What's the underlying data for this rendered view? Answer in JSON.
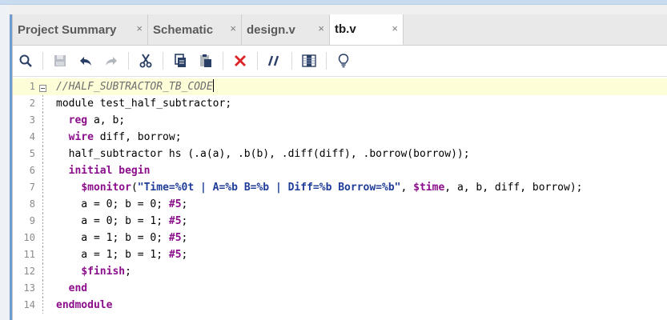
{
  "tabs": [
    {
      "label": "Project Summary",
      "active": false
    },
    {
      "label": "Schematic",
      "active": false
    },
    {
      "label": "design.v",
      "active": false
    },
    {
      "label": "tb.v",
      "active": true
    }
  ],
  "close_glyph": "×",
  "toolbar": [
    {
      "name": "search-icon"
    },
    {
      "name": "save-icon"
    },
    {
      "name": "undo-icon"
    },
    {
      "name": "redo-icon"
    },
    {
      "name": "cut-icon"
    },
    {
      "name": "copy-icon"
    },
    {
      "name": "paste-icon"
    },
    {
      "name": "delete-icon"
    },
    {
      "name": "comment-toggle-icon"
    },
    {
      "name": "column-block-icon"
    },
    {
      "name": "lightbulb-icon"
    }
  ],
  "editor": {
    "current_line": 1,
    "lines": [
      {
        "num": "1",
        "segs": [
          {
            "t": "//HALF_SUBTRACTOR_TB_CODE",
            "c": "cm"
          }
        ]
      },
      {
        "num": "2",
        "segs": [
          {
            "t": "module test_half_subtractor;",
            "c": ""
          }
        ]
      },
      {
        "num": "3",
        "segs": [
          {
            "t": "  ",
            "c": ""
          },
          {
            "t": "reg",
            "c": "k"
          },
          {
            "t": " a, b;",
            "c": ""
          }
        ]
      },
      {
        "num": "4",
        "segs": [
          {
            "t": "  ",
            "c": ""
          },
          {
            "t": "wire",
            "c": "k"
          },
          {
            "t": " diff, borrow;",
            "c": ""
          }
        ]
      },
      {
        "num": "5",
        "segs": [
          {
            "t": "  half_subtractor hs (.a(a), .b(b), .diff(diff), .borrow(borrow));",
            "c": ""
          }
        ]
      },
      {
        "num": "6",
        "segs": [
          {
            "t": "  ",
            "c": ""
          },
          {
            "t": "initial begin",
            "c": "k2"
          }
        ]
      },
      {
        "num": "7",
        "segs": [
          {
            "t": "    ",
            "c": ""
          },
          {
            "t": "$monitor",
            "c": "k"
          },
          {
            "t": "(",
            "c": ""
          },
          {
            "t": "\"Time=%0t | A=%b B=%b | Diff=%b Borrow=%b\"",
            "c": "str"
          },
          {
            "t": ", ",
            "c": ""
          },
          {
            "t": "$time",
            "c": "k"
          },
          {
            "t": ", a, b, diff, borrow);",
            "c": ""
          }
        ]
      },
      {
        "num": "8",
        "segs": [
          {
            "t": "    a = 0; b = 0; ",
            "c": ""
          },
          {
            "t": "#5",
            "c": "k"
          },
          {
            "t": ";",
            "c": ""
          }
        ]
      },
      {
        "num": "9",
        "segs": [
          {
            "t": "    a = 0; b = 1; ",
            "c": ""
          },
          {
            "t": "#5",
            "c": "k"
          },
          {
            "t": ";",
            "c": ""
          }
        ]
      },
      {
        "num": "10",
        "segs": [
          {
            "t": "    a = 1; b = 0; ",
            "c": ""
          },
          {
            "t": "#5",
            "c": "k"
          },
          {
            "t": ";",
            "c": ""
          }
        ]
      },
      {
        "num": "11",
        "segs": [
          {
            "t": "    a = 1; b = 1; ",
            "c": ""
          },
          {
            "t": "#5",
            "c": "k"
          },
          {
            "t": ";",
            "c": ""
          }
        ]
      },
      {
        "num": "12",
        "segs": [
          {
            "t": "    ",
            "c": ""
          },
          {
            "t": "$finish",
            "c": "k"
          },
          {
            "t": ";",
            "c": ""
          }
        ]
      },
      {
        "num": "13",
        "segs": [
          {
            "t": "  ",
            "c": ""
          },
          {
            "t": "end",
            "c": "k2"
          }
        ]
      },
      {
        "num": "14",
        "segs": [
          {
            "t": "endmodule",
            "c": "k2"
          }
        ]
      }
    ]
  },
  "colors": {
    "keyword": "#8b0d8b",
    "comment": "#6e6e6e",
    "string": "#1f3c99",
    "current_line": "#fdfdd8"
  }
}
